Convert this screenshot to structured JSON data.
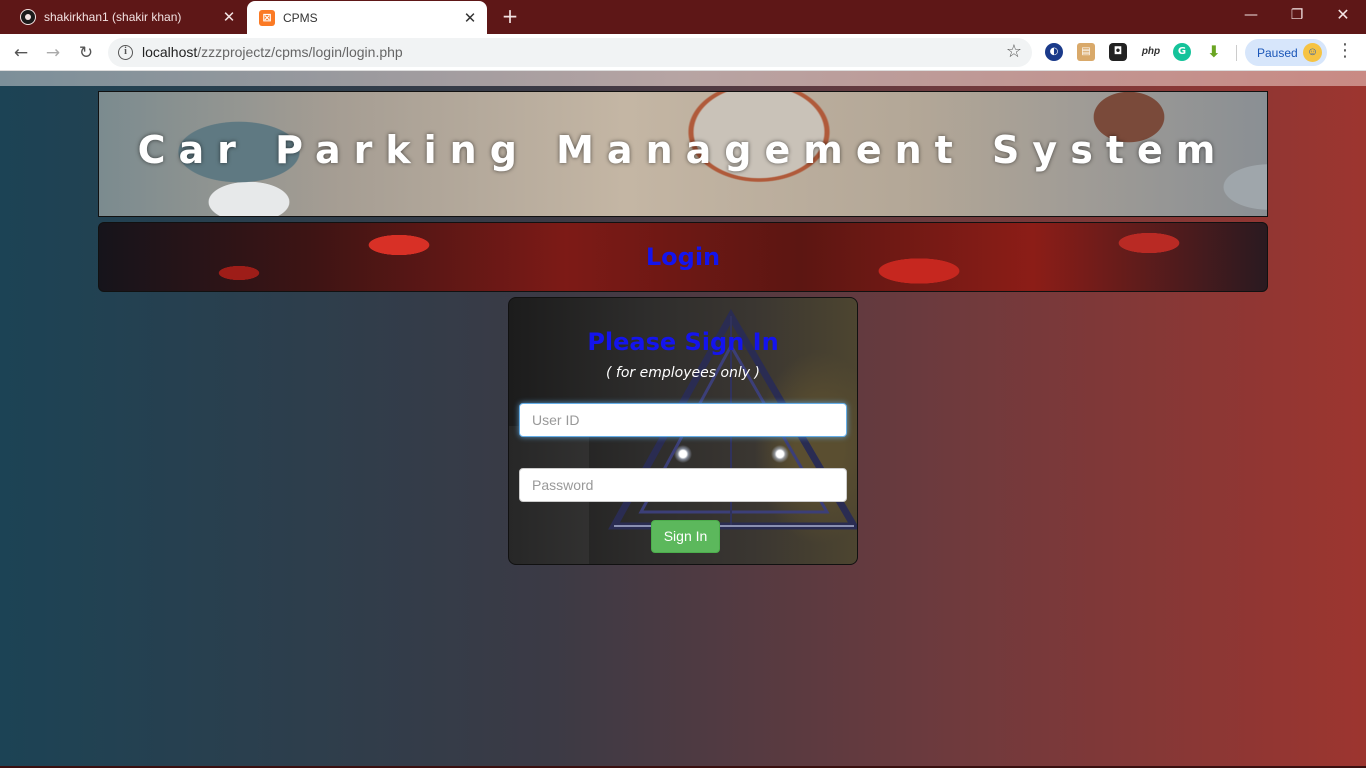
{
  "browser": {
    "tabs": [
      {
        "title": "shakirkhan1 (shakir khan)",
        "icon": "github-icon",
        "active": false
      },
      {
        "title": "CPMS",
        "icon": "xampp-icon",
        "active": true
      }
    ],
    "url_host": "localhost",
    "url_path": "/zzzprojectz/cpms/login/login.php",
    "profile_label": "Paused",
    "extension_php_label": "php",
    "colors": {
      "tabbar": "#5e1717",
      "profile_chip": "#d7e6fb"
    }
  },
  "page": {
    "banner_title": "Car Parking Management System",
    "login_strip_title": "Login",
    "card": {
      "title": "Please Sign In",
      "subtitle": "( for employees only )",
      "userid_placeholder": "User ID",
      "password_placeholder": "Password",
      "signin_label": "Sign In"
    },
    "colors": {
      "heading_blue": "#1414ee",
      "signin_green": "#5cb85c",
      "bg_left": "#1c4355",
      "bg_right": "#9d352f"
    }
  }
}
